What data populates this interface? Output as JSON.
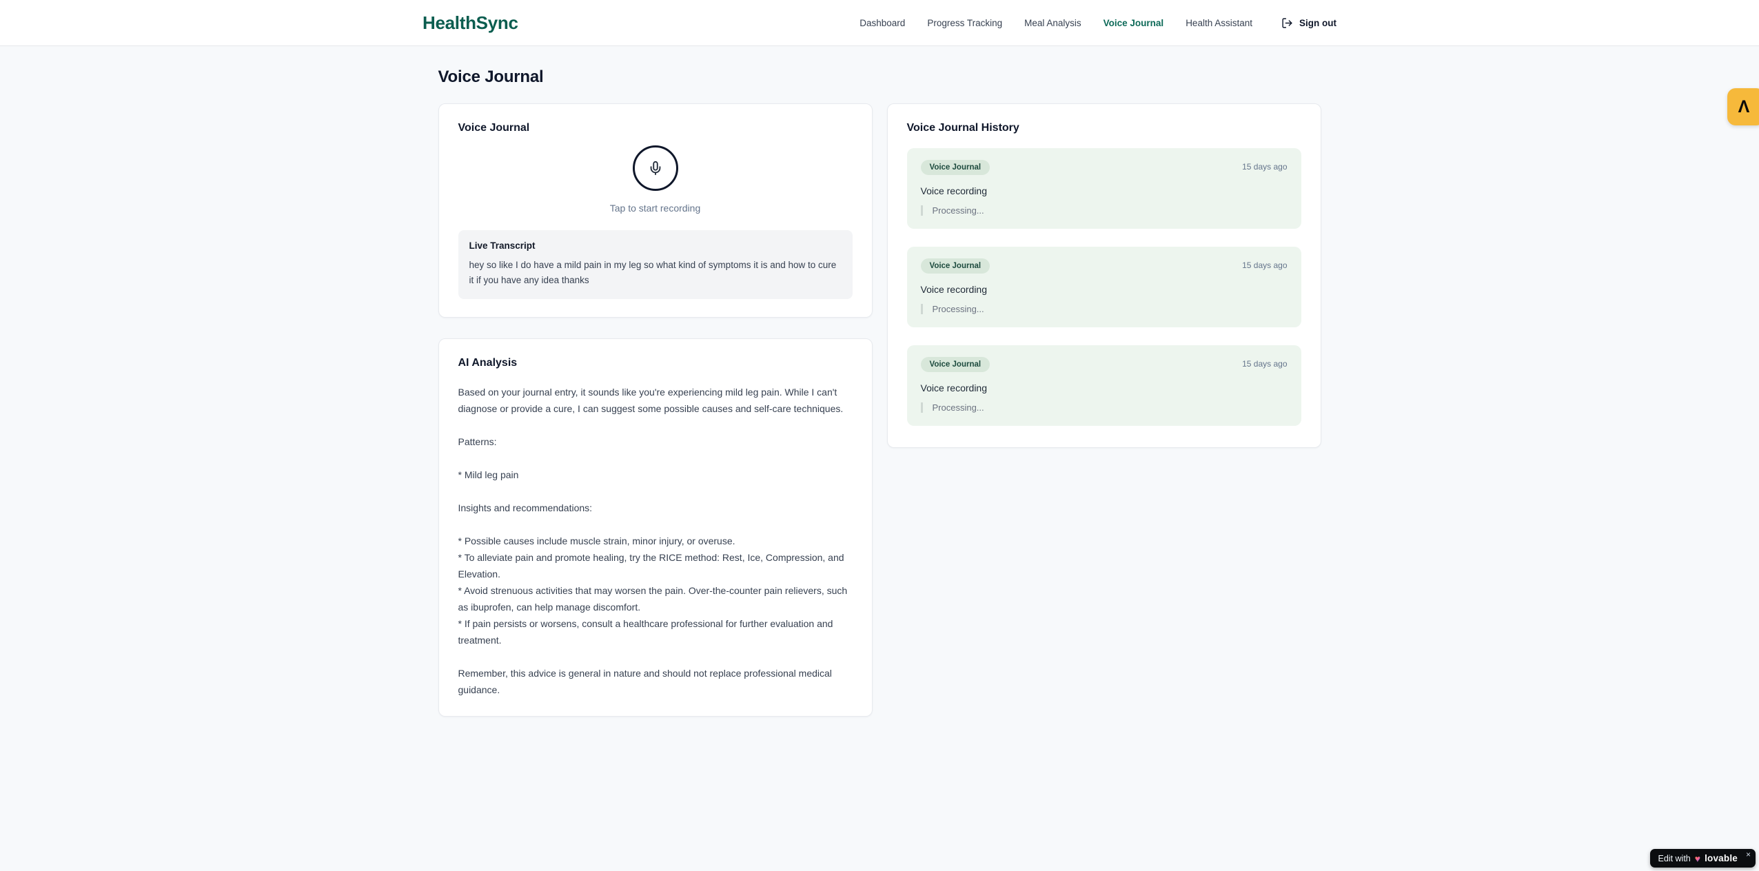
{
  "brand": {
    "name": "HealthSync"
  },
  "nav": {
    "items": [
      {
        "label": "Dashboard",
        "active": false
      },
      {
        "label": "Progress Tracking",
        "active": false
      },
      {
        "label": "Meal Analysis",
        "active": false
      },
      {
        "label": "Voice Journal",
        "active": true
      },
      {
        "label": "Health Assistant",
        "active": false
      }
    ],
    "sign_out_label": "Sign out"
  },
  "page": {
    "title": "Voice Journal"
  },
  "recorder": {
    "card_title": "Voice Journal",
    "tap_hint": "Tap to start recording",
    "live_transcript_label": "Live Transcript",
    "transcript": "hey so like I do have a mild pain in my leg so what kind of symptoms it is and how to cure it if you have any idea thanks"
  },
  "analysis": {
    "card_title": "AI Analysis",
    "body": "Based on your journal entry, it sounds like you're experiencing mild leg pain. While I can't diagnose or provide a cure, I can suggest some possible causes and self-care techniques.\n\nPatterns:\n\n* Mild leg pain\n\nInsights and recommendations:\n\n* Possible causes include muscle strain, minor injury, or overuse.\n* To alleviate pain and promote healing, try the RICE method: Rest, Ice, Compression, and Elevation.\n* Avoid strenuous activities that may worsen the pain. Over-the-counter pain relievers, such as ibuprofen, can help manage discomfort.\n* If pain persists or worsens, consult a healthcare professional for further evaluation and treatment.\n\nRemember, this advice is general in nature and should not replace professional medical guidance."
  },
  "history": {
    "card_title": "Voice Journal History",
    "entries": [
      {
        "badge": "Voice Journal",
        "time": "15 days ago",
        "title": "Voice recording",
        "status": "Processing..."
      },
      {
        "badge": "Voice Journal",
        "time": "15 days ago",
        "title": "Voice recording",
        "status": "Processing..."
      },
      {
        "badge": "Voice Journal",
        "time": "15 days ago",
        "title": "Voice recording",
        "status": "Processing..."
      }
    ]
  },
  "widgets": {
    "side_badge_glyph": "Λ",
    "lovable": {
      "edit_with": "Edit with",
      "heart": "♥",
      "brand": "lovable",
      "close": "×"
    }
  },
  "colors": {
    "brand_green": "#0b5d4f",
    "active_nav": "#0d6a58",
    "page_bg": "#f7f9fb",
    "entry_bg": "#edf5ee",
    "badge_bg": "#d8e7da",
    "badge_text": "#1d4b3e",
    "side_badge_bg": "#f6b93b",
    "lovable_bg": "#0b0d10"
  }
}
